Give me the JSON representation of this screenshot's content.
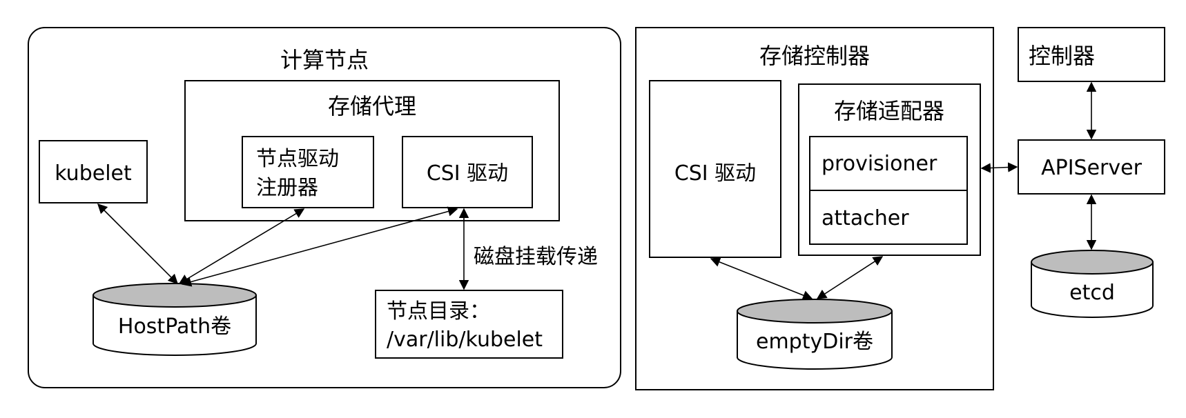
{
  "compute_node": {
    "title": "计算节点",
    "storage_agent": {
      "title": "存储代理",
      "node_driver_registrar": [
        "节点驱动",
        "注册器"
      ],
      "csi_driver": "CSI 驱动"
    },
    "kubelet": "kubelet",
    "hostpath_volume": "HostPath卷",
    "node_directory": [
      "节点目录：",
      "/var/lib/kubelet"
    ],
    "disk_mount_label": "磁盘挂载传递"
  },
  "storage_controller": {
    "title": "存储控制器",
    "csi_driver": "CSI 驱动",
    "storage_adapter": {
      "title": "存储适配器",
      "provisioner": "provisioner",
      "attacher": "attacher"
    },
    "emptydir_volume": "emptyDir卷"
  },
  "control_plane": {
    "controller": "控制器",
    "apiserver": "APIServer",
    "etcd": "etcd"
  },
  "colors": {
    "cylinder_top": "#bdbdbd",
    "stroke": "#000000"
  }
}
